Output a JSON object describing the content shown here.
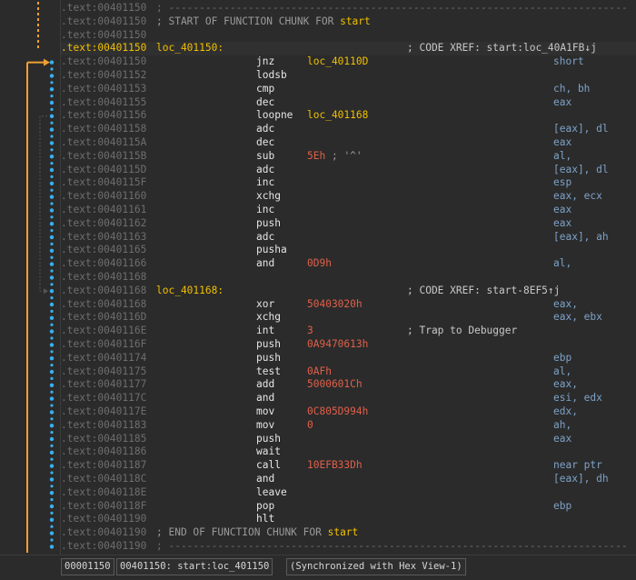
{
  "lines": [
    {
      "seg": ".text:",
      "addr": "00401150",
      "kind": "dash",
      "text": "; ---------------------------------------------------------------------------"
    },
    {
      "seg": ".text:",
      "addr": "00401150",
      "kind": "chunk",
      "pre": "; START OF FUNCTION CHUNK FOR ",
      "fn": "start"
    },
    {
      "seg": ".text:",
      "addr": "00401150",
      "kind": "blank"
    },
    {
      "seg": ".text:",
      "addr": "00401150",
      "kind": "label",
      "label": "loc_401150:",
      "xref": "; CODE XREF: start:loc_40A1FB↓j",
      "current": true
    },
    {
      "seg": ".text:",
      "addr": "00401150",
      "kind": "ins",
      "mn": "jnz",
      "op": [
        {
          "t": "short ",
          "c": "op"
        },
        {
          "t": "loc_40110D",
          "c": "name"
        }
      ]
    },
    {
      "seg": ".text:",
      "addr": "00401152",
      "kind": "ins",
      "mn": "lodsb",
      "op": []
    },
    {
      "seg": ".text:",
      "addr": "00401153",
      "kind": "ins",
      "mn": "cmp",
      "op": [
        {
          "t": "ch, bh",
          "c": "op"
        }
      ]
    },
    {
      "seg": ".text:",
      "addr": "00401155",
      "kind": "ins",
      "mn": "dec",
      "op": [
        {
          "t": "eax",
          "c": "op"
        }
      ]
    },
    {
      "seg": ".text:",
      "addr": "00401156",
      "kind": "ins",
      "mn": "loopne",
      "op": [
        {
          "t": "loc_401168",
          "c": "name"
        }
      ]
    },
    {
      "seg": ".text:",
      "addr": "00401158",
      "kind": "ins",
      "mn": "adc",
      "op": [
        {
          "t": "[eax], dl",
          "c": "op"
        }
      ]
    },
    {
      "seg": ".text:",
      "addr": "0040115A",
      "kind": "ins",
      "mn": "dec",
      "op": [
        {
          "t": "eax",
          "c": "op"
        }
      ]
    },
    {
      "seg": ".text:",
      "addr": "0040115B",
      "kind": "ins",
      "mn": "sub",
      "op": [
        {
          "t": "al, ",
          "c": "op"
        },
        {
          "t": "5Eh",
          "c": "num"
        },
        {
          "t": " ; ",
          "c": "cmt"
        },
        {
          "t": "'^'",
          "c": "cmt"
        }
      ]
    },
    {
      "seg": ".text:",
      "addr": "0040115D",
      "kind": "ins",
      "mn": "adc",
      "op": [
        {
          "t": "[eax], dl",
          "c": "op"
        }
      ]
    },
    {
      "seg": ".text:",
      "addr": "0040115F",
      "kind": "ins",
      "mn": "inc",
      "op": [
        {
          "t": "esp",
          "c": "op"
        }
      ]
    },
    {
      "seg": ".text:",
      "addr": "00401160",
      "kind": "ins",
      "mn": "xchg",
      "op": [
        {
          "t": "eax, ecx",
          "c": "op"
        }
      ]
    },
    {
      "seg": ".text:",
      "addr": "00401161",
      "kind": "ins",
      "mn": "inc",
      "op": [
        {
          "t": "eax",
          "c": "op"
        }
      ]
    },
    {
      "seg": ".text:",
      "addr": "00401162",
      "kind": "ins",
      "mn": "push",
      "op": [
        {
          "t": "eax",
          "c": "op"
        }
      ]
    },
    {
      "seg": ".text:",
      "addr": "00401163",
      "kind": "ins",
      "mn": "adc",
      "op": [
        {
          "t": "[eax], ah",
          "c": "op"
        }
      ]
    },
    {
      "seg": ".text:",
      "addr": "00401165",
      "kind": "ins",
      "mn": "pusha",
      "op": []
    },
    {
      "seg": ".text:",
      "addr": "00401166",
      "kind": "ins",
      "mn": "and",
      "op": [
        {
          "t": "al, ",
          "c": "op"
        },
        {
          "t": "0D9h",
          "c": "num"
        }
      ]
    },
    {
      "seg": ".text:",
      "addr": "00401168",
      "kind": "blank"
    },
    {
      "seg": ".text:",
      "addr": "00401168",
      "kind": "label",
      "label": "loc_401168:",
      "xref": "; CODE XREF: start-8EF5↑j"
    },
    {
      "seg": ".text:",
      "addr": "00401168",
      "kind": "ins",
      "mn": "xor",
      "op": [
        {
          "t": "eax, ",
          "c": "op"
        },
        {
          "t": "50403020h",
          "c": "num"
        }
      ]
    },
    {
      "seg": ".text:",
      "addr": "0040116D",
      "kind": "ins",
      "mn": "xchg",
      "op": [
        {
          "t": "eax, ebx",
          "c": "op"
        }
      ]
    },
    {
      "seg": ".text:",
      "addr": "0040116E",
      "kind": "ins",
      "mn": "int",
      "op": [
        {
          "t": "3",
          "c": "num"
        }
      ],
      "cmt": "; Trap to Debugger"
    },
    {
      "seg": ".text:",
      "addr": "0040116F",
      "kind": "ins",
      "mn": "push",
      "op": [
        {
          "t": "0A9470613h",
          "c": "num"
        }
      ]
    },
    {
      "seg": ".text:",
      "addr": "00401174",
      "kind": "ins",
      "mn": "push",
      "op": [
        {
          "t": "ebp",
          "c": "op"
        }
      ]
    },
    {
      "seg": ".text:",
      "addr": "00401175",
      "kind": "ins",
      "mn": "test",
      "op": [
        {
          "t": "al, ",
          "c": "op"
        },
        {
          "t": "0AFh",
          "c": "num"
        }
      ]
    },
    {
      "seg": ".text:",
      "addr": "00401177",
      "kind": "ins",
      "mn": "add",
      "op": [
        {
          "t": "eax, ",
          "c": "op"
        },
        {
          "t": "5000601Ch",
          "c": "num"
        }
      ]
    },
    {
      "seg": ".text:",
      "addr": "0040117C",
      "kind": "ins",
      "mn": "and",
      "op": [
        {
          "t": "esi, edx",
          "c": "op"
        }
      ]
    },
    {
      "seg": ".text:",
      "addr": "0040117E",
      "kind": "ins",
      "mn": "mov",
      "op": [
        {
          "t": "edx, ",
          "c": "op"
        },
        {
          "t": "0C805D994h",
          "c": "num"
        }
      ]
    },
    {
      "seg": ".text:",
      "addr": "00401183",
      "kind": "ins",
      "mn": "mov",
      "op": [
        {
          "t": "ah, ",
          "c": "op"
        },
        {
          "t": "0",
          "c": "num"
        }
      ]
    },
    {
      "seg": ".text:",
      "addr": "00401185",
      "kind": "ins",
      "mn": "push",
      "op": [
        {
          "t": "eax",
          "c": "op"
        }
      ]
    },
    {
      "seg": ".text:",
      "addr": "00401186",
      "kind": "ins",
      "mn": "wait",
      "op": []
    },
    {
      "seg": ".text:",
      "addr": "00401187",
      "kind": "ins",
      "mn": "call",
      "op": [
        {
          "t": "near ptr ",
          "c": "op"
        },
        {
          "t": "10EFB33Dh",
          "c": "num"
        }
      ]
    },
    {
      "seg": ".text:",
      "addr": "0040118C",
      "kind": "ins",
      "mn": "and",
      "op": [
        {
          "t": "[eax], dh",
          "c": "op"
        }
      ]
    },
    {
      "seg": ".text:",
      "addr": "0040118E",
      "kind": "ins",
      "mn": "leave",
      "op": []
    },
    {
      "seg": ".text:",
      "addr": "0040118F",
      "kind": "ins",
      "mn": "pop",
      "op": [
        {
          "t": "ebp",
          "c": "op"
        }
      ]
    },
    {
      "seg": ".text:",
      "addr": "00401190",
      "kind": "ins",
      "mn": "hlt",
      "op": []
    },
    {
      "seg": ".text:",
      "addr": "00401190",
      "kind": "chunk",
      "pre": "; END OF FUNCTION CHUNK FOR ",
      "fn": "start"
    },
    {
      "seg": ".text:",
      "addr": "00401190",
      "kind": "dash",
      "text": "; ---------------------------------------------------------------------------"
    }
  ],
  "status": {
    "offset": "00001150",
    "location": "00401150: start:loc_401150",
    "sync": "(Synchronized with Hex View-1)"
  },
  "colors": {
    "background": "#2b2b2b",
    "address": "#6e6e6e",
    "label": "#f0c000",
    "number": "#e0604a",
    "operand": "#7ea2c8",
    "arrow_main": "#f0a030",
    "arrow_dots": "#3ab0f0"
  }
}
